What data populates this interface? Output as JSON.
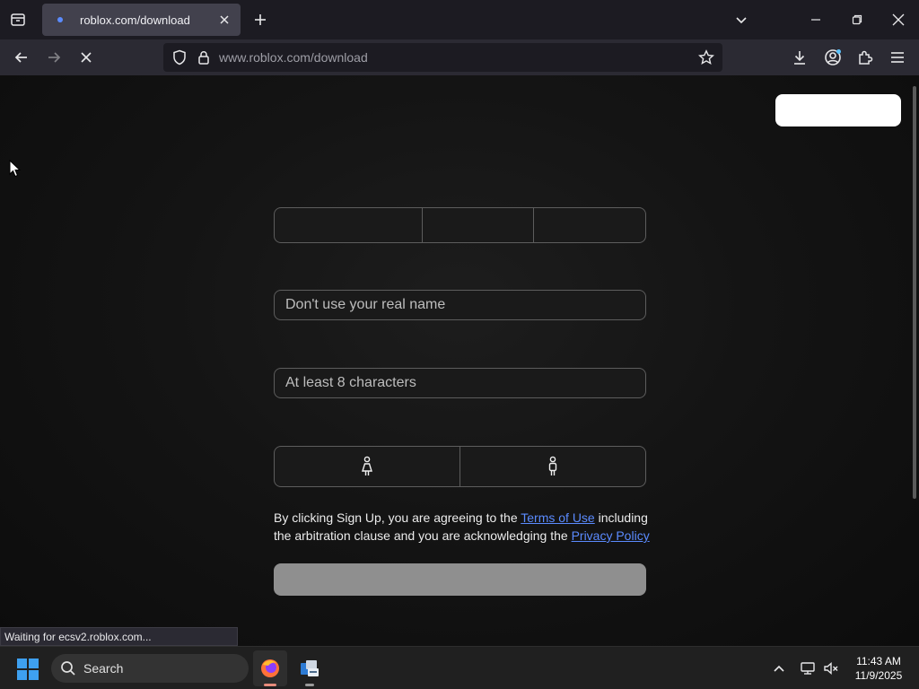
{
  "browser": {
    "tab_title": "roblox.com/download",
    "url_host": "www.roblox.com",
    "url_path": "/download",
    "status": "Waiting for ecsv2.roblox.com..."
  },
  "form": {
    "username_placeholder": "Don't use your real name",
    "password_placeholder": "At least 8 characters",
    "terms_prefix": "By clicking Sign Up, you are agreeing to the ",
    "terms_link": "Terms of Use",
    "terms_middle": " including the arbitration clause and you are acknowledging the ",
    "privacy_link": "Privacy Policy"
  },
  "taskbar": {
    "search_label": "Search",
    "time": "11:43 AM",
    "date": "11/9/2025"
  },
  "colors": {
    "link": "#5b8bff",
    "tab_dot": "#5b8cff",
    "signup_disabled": "#8f8f8f"
  }
}
